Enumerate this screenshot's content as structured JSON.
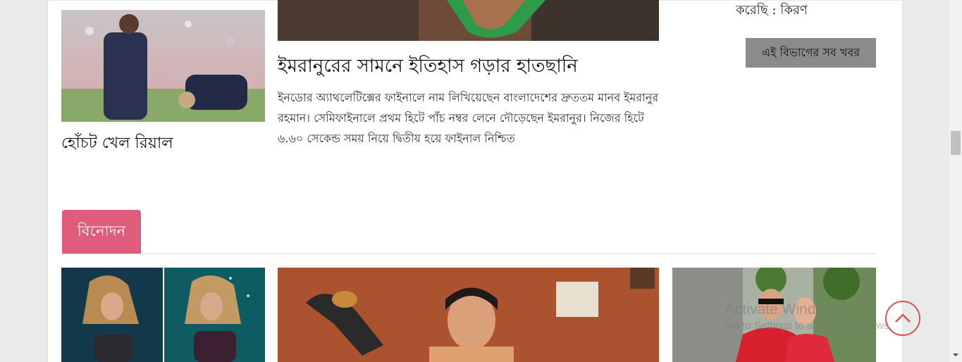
{
  "sports": {
    "card_small": {
      "title": "হোঁচট খেল রিয়াল",
      "image": "real-madrid-players-photo"
    },
    "card_big": {
      "title": "ইমরানুরের সামনে ইতিহাস গড়ার হাতছানি",
      "excerpt": "ইনডোর অ্যাথলেটিক্সের ফাইনালে নাম লিখিয়েছেন বাংলাদেশের দ্রুততম মানব ইমরানুর রহমান। সেমিফাইনালে প্রথম হিটে পাঁচ নম্বর লেনে দৌড়েছেন ইমরানুর। নিজের হিটে ৬.৬০ সেকেন্ড সময় নিয়ে দ্বিতীয় হয়ে ফাইনাল নিশ্চিত",
      "image": "athlete-photo"
    },
    "sidebar_caption": "করেছি : কিরণ",
    "all_news_label": "এই বিভাগের সব খবর"
  },
  "entertainment": {
    "section_label": "বিনোদন",
    "images": [
      "shakira-photo",
      "actor-at-desk-photo",
      "couple-movie-still-photo"
    ]
  },
  "watermark": {
    "line1": "Activate Windows",
    "line2": "Go to Settings to activate Windows."
  },
  "colors": {
    "section_tab": "#e05c7b",
    "button_bg": "#8b8b8b",
    "scroll_top_ring": "#d9534f"
  }
}
